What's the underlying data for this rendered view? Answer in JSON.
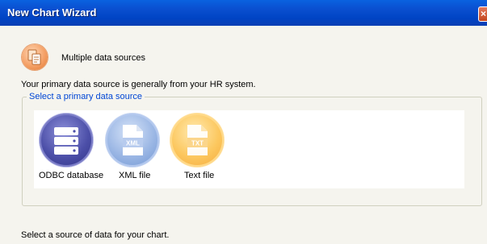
{
  "window": {
    "title": "New Chart Wizard",
    "close_glyph": "×"
  },
  "header": {
    "icon": "multiple-data-sources-icon",
    "text": "Multiple data sources"
  },
  "description": "Your primary data source is generally from your HR system.",
  "group": {
    "legend": "Select a primary data source",
    "sources": [
      {
        "label": "ODBC database",
        "icon": "database-icon",
        "color": "#4c4fa8"
      },
      {
        "label": "XML file",
        "icon": "xml-file-icon",
        "badge": "XML",
        "color": "#9ab6e4"
      },
      {
        "label": "Text file",
        "icon": "text-file-icon",
        "badge": "TXT",
        "color": "#fcc75e"
      }
    ]
  },
  "footer": "Select a source of data for your chart.",
  "colors": {
    "titlebar": "#0044c4",
    "legend_text": "#0046d5",
    "header_icon": "#f4a066"
  }
}
